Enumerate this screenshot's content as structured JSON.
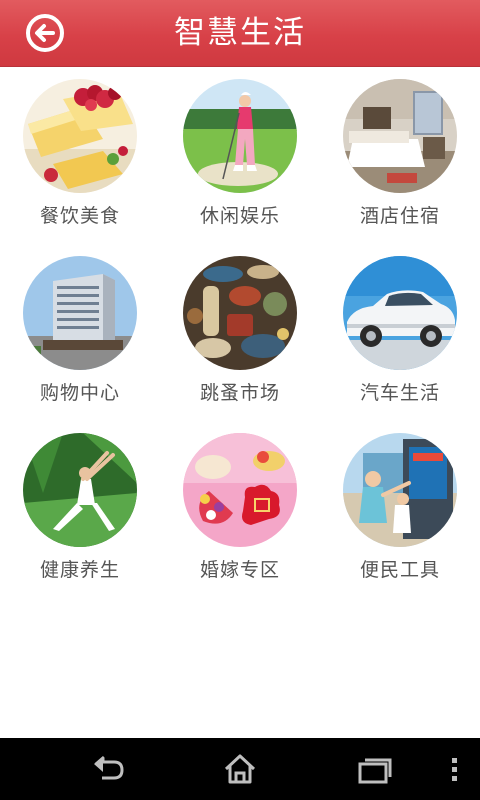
{
  "header": {
    "title": "智慧生活",
    "back_icon": "back-arrow-circle-icon",
    "background": "#d84148"
  },
  "categories": [
    {
      "label": "餐饮美食",
      "image": "cake-dessert-photo"
    },
    {
      "label": "休闲娱乐",
      "image": "golfer-photo"
    },
    {
      "label": "酒店住宿",
      "image": "hotel-room-photo"
    },
    {
      "label": "购物中心",
      "image": "office-building-photo"
    },
    {
      "label": "跳蚤市场",
      "image": "antiques-collection-photo"
    },
    {
      "label": "汽车生活",
      "image": "white-car-photo"
    },
    {
      "label": "健康养生",
      "image": "yoga-woman-photo"
    },
    {
      "label": "婚嫁专区",
      "image": "wedding-candy-box-photo"
    },
    {
      "label": "便民工具",
      "image": "kiosk-children-photo"
    }
  ],
  "navbar": {
    "back_icon": "nav-back-icon",
    "home_icon": "nav-home-icon",
    "recents_icon": "nav-recent-apps-icon",
    "menu_icon": "nav-overflow-menu-icon"
  },
  "colors": {
    "header": "#d84148",
    "label_text": "#555555",
    "nav_background": "#000000"
  }
}
